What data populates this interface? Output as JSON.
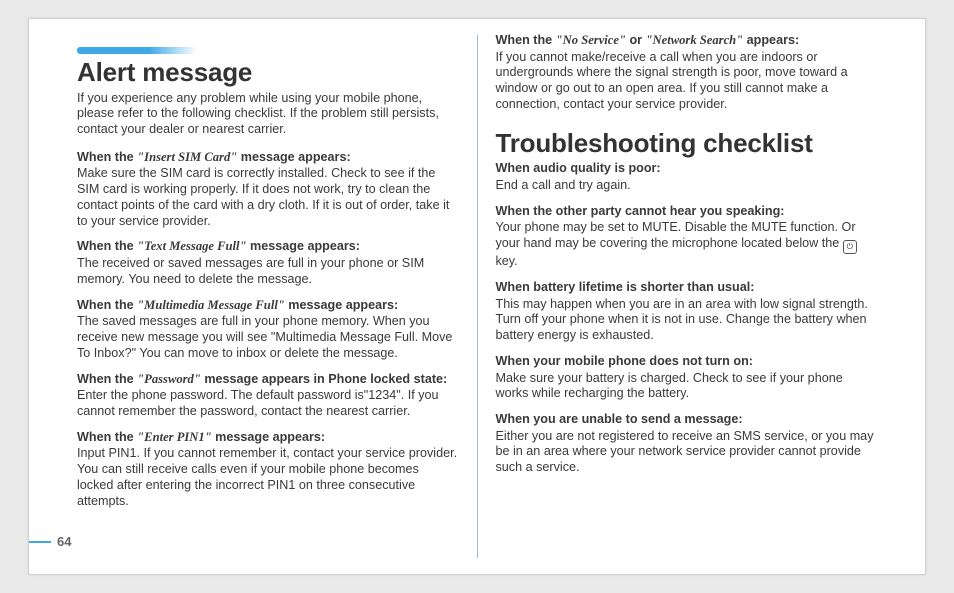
{
  "pageNumber": "64",
  "left": {
    "heading": "Alert message",
    "intro": "If you experience any problem while using your mobile phone, please refer to the following checklist. If the problem still persists, contact your dealer or nearest carrier.",
    "items": [
      {
        "prefix": "When the ",
        "quoted": "\"Insert SIM Card\"",
        "suffix": " message appears:",
        "body": "Make sure the SIM card is correctly installed. Check to see if the SIM card is working properly. If it does not work, try to clean the contact points of the card with a dry cloth. If it is out of order, take it to your service provider."
      },
      {
        "prefix": "When the ",
        "quoted": "\"Text Message Full\"",
        "suffix": " message appears:",
        "body": "The received or saved messages are full in your phone or SIM memory. You need to delete the message."
      },
      {
        "prefix": "When the ",
        "quoted": "\"Multimedia Message Full\"",
        "suffix": " message appears:",
        "body": "The saved messages are full in your phone memory. When you receive new message you will see \"Multimedia Message Full. Move To Inbox?\" You can move to inbox or delete the message."
      },
      {
        "prefix": "When the ",
        "quoted": "\"Password\"",
        "suffix": " message appears in Phone locked state:",
        "body": "Enter the phone password. The default password is\"1234\". If you cannot remember the password, contact the nearest carrier."
      },
      {
        "prefix": "When the ",
        "quoted": "\"Enter PIN1\"",
        "suffix": " message appears:",
        "body": "Input PIN1. If you cannot remember it, contact your service provider. You can still receive calls even if your mobile phone becomes locked after entering the incorrect PIN1 on three consecutive attempts."
      }
    ]
  },
  "right": {
    "topItem": {
      "prefix": "When the ",
      "quoted": "\"No Service\"",
      "mid": " or ",
      "quoted2": "\"Network Search\"",
      "suffix": " appears:",
      "body": "If you cannot make/receive a call when you are indoors or undergrounds where the signal strength is poor, move toward a window or go out to an open area. If you still cannot make a connection, contact your service provider."
    },
    "heading": "Troubleshooting checklist",
    "items": [
      {
        "label": "When audio quality is poor:",
        "body": "End a call and try again."
      },
      {
        "label": "When the other party cannot hear you speaking:",
        "body_pre": "Your phone may be set to MUTE. Disable the MUTE function. Or your hand may be covering the microphone located below the ",
        "body_post": " key.",
        "has_icon": true
      },
      {
        "label": "When battery lifetime is shorter than usual:",
        "body": "This may happen when you are in an area with low signal strength. Turn off your phone when it is not in use. Change the battery when battery energy is exhausted."
      },
      {
        "label": "When your mobile phone does not turn on:",
        "body": "Make sure your battery is charged. Check to see if your phone works while recharging the battery."
      },
      {
        "label": "When you are unable to send a message:",
        "body": "Either you are not registered to receive an SMS service, or you may be in an area where your network service provider cannot provide such a service."
      }
    ]
  }
}
